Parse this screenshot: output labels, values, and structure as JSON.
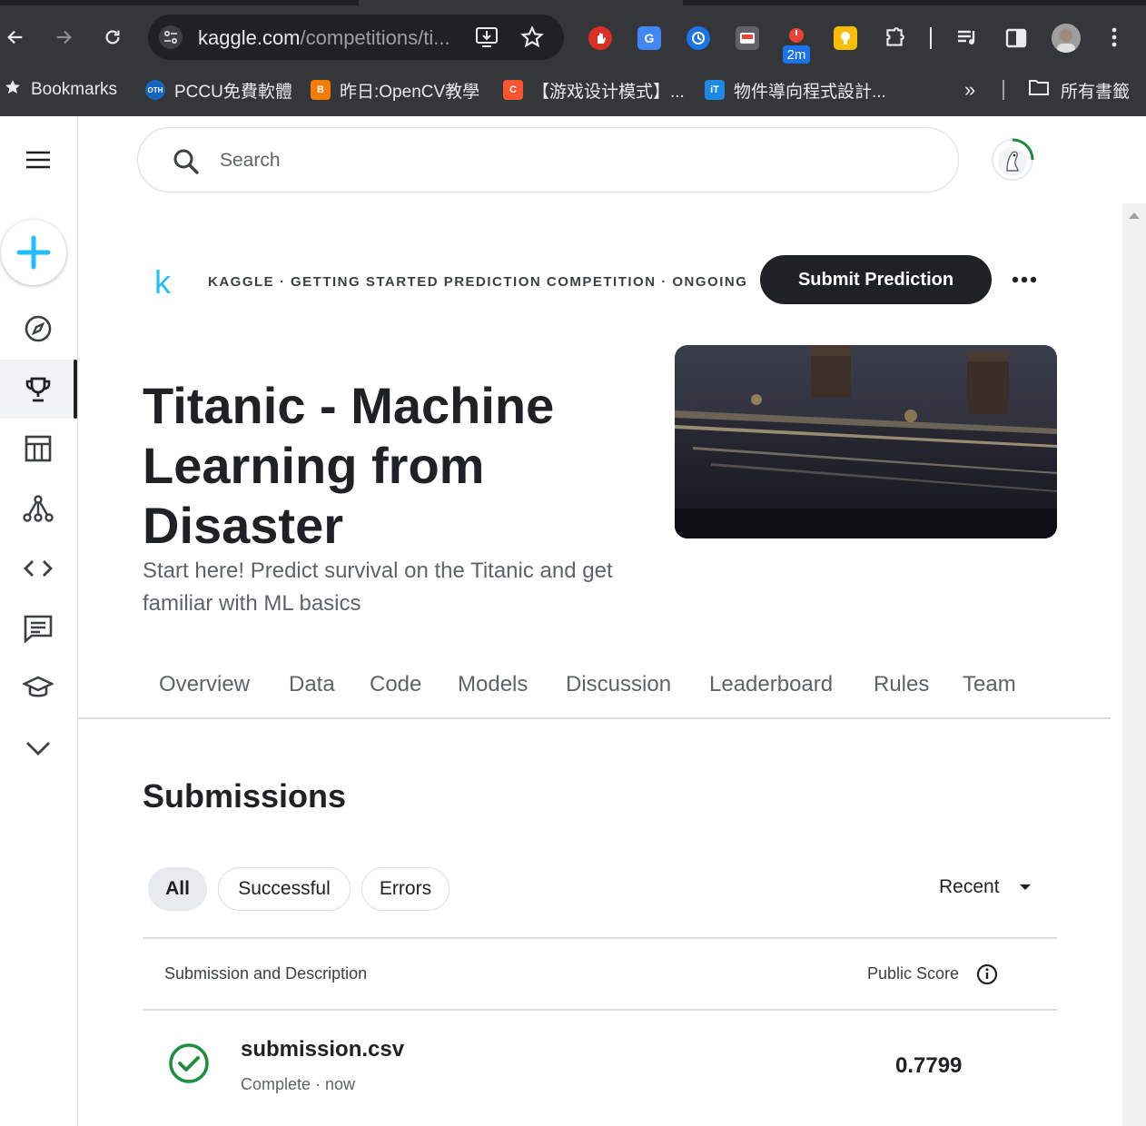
{
  "browser": {
    "url_host": "kaggle.com",
    "url_path": "/competitions/ti...",
    "extension_badge": "2m",
    "bookmarks": [
      {
        "label": "Bookmarks",
        "icon": "star-icon"
      },
      {
        "label": "PCCU免費軟體",
        "icon": "oth-favicon",
        "fav_text": "OTH"
      },
      {
        "label": "昨日:OpenCV教學",
        "icon": "blogger-favicon",
        "fav_text": "B"
      },
      {
        "label": "【游戏设计模式】...",
        "icon": "csdn-favicon",
        "fav_text": "C"
      },
      {
        "label": "物件導向程式設計...",
        "icon": "ithome-favicon",
        "fav_text": "iT"
      }
    ],
    "overflow_label": "»",
    "all_bookmarks_label": "所有書籤"
  },
  "search": {
    "placeholder": "Search"
  },
  "competition": {
    "brand_letter": "k",
    "breadcrumb": "KAGGLE · GETTING STARTED PREDICTION COMPETITION · ONGOING",
    "submit_label": "Submit Prediction",
    "more_label": "•••",
    "title": "Titanic - Machine Learning from Disaster",
    "subtitle": "Start here! Predict survival on the Titanic and get familiar with ML basics"
  },
  "tabs": [
    "Overview",
    "Data",
    "Code",
    "Models",
    "Discussion",
    "Leaderboard",
    "Rules",
    "Team"
  ],
  "submissions": {
    "heading": "Submissions",
    "filters": [
      "All",
      "Successful",
      "Errors"
    ],
    "active_filter": "All",
    "sort_label": "Recent",
    "col_submission": "Submission and Description",
    "col_score": "Public Score",
    "rows": [
      {
        "file": "submission.csv",
        "status": "Complete · now",
        "score": "0.7799"
      }
    ]
  },
  "colors": {
    "accent": "#20beff",
    "dark": "#202124",
    "success": "#1e8e3e",
    "chrome": "#35363a"
  }
}
